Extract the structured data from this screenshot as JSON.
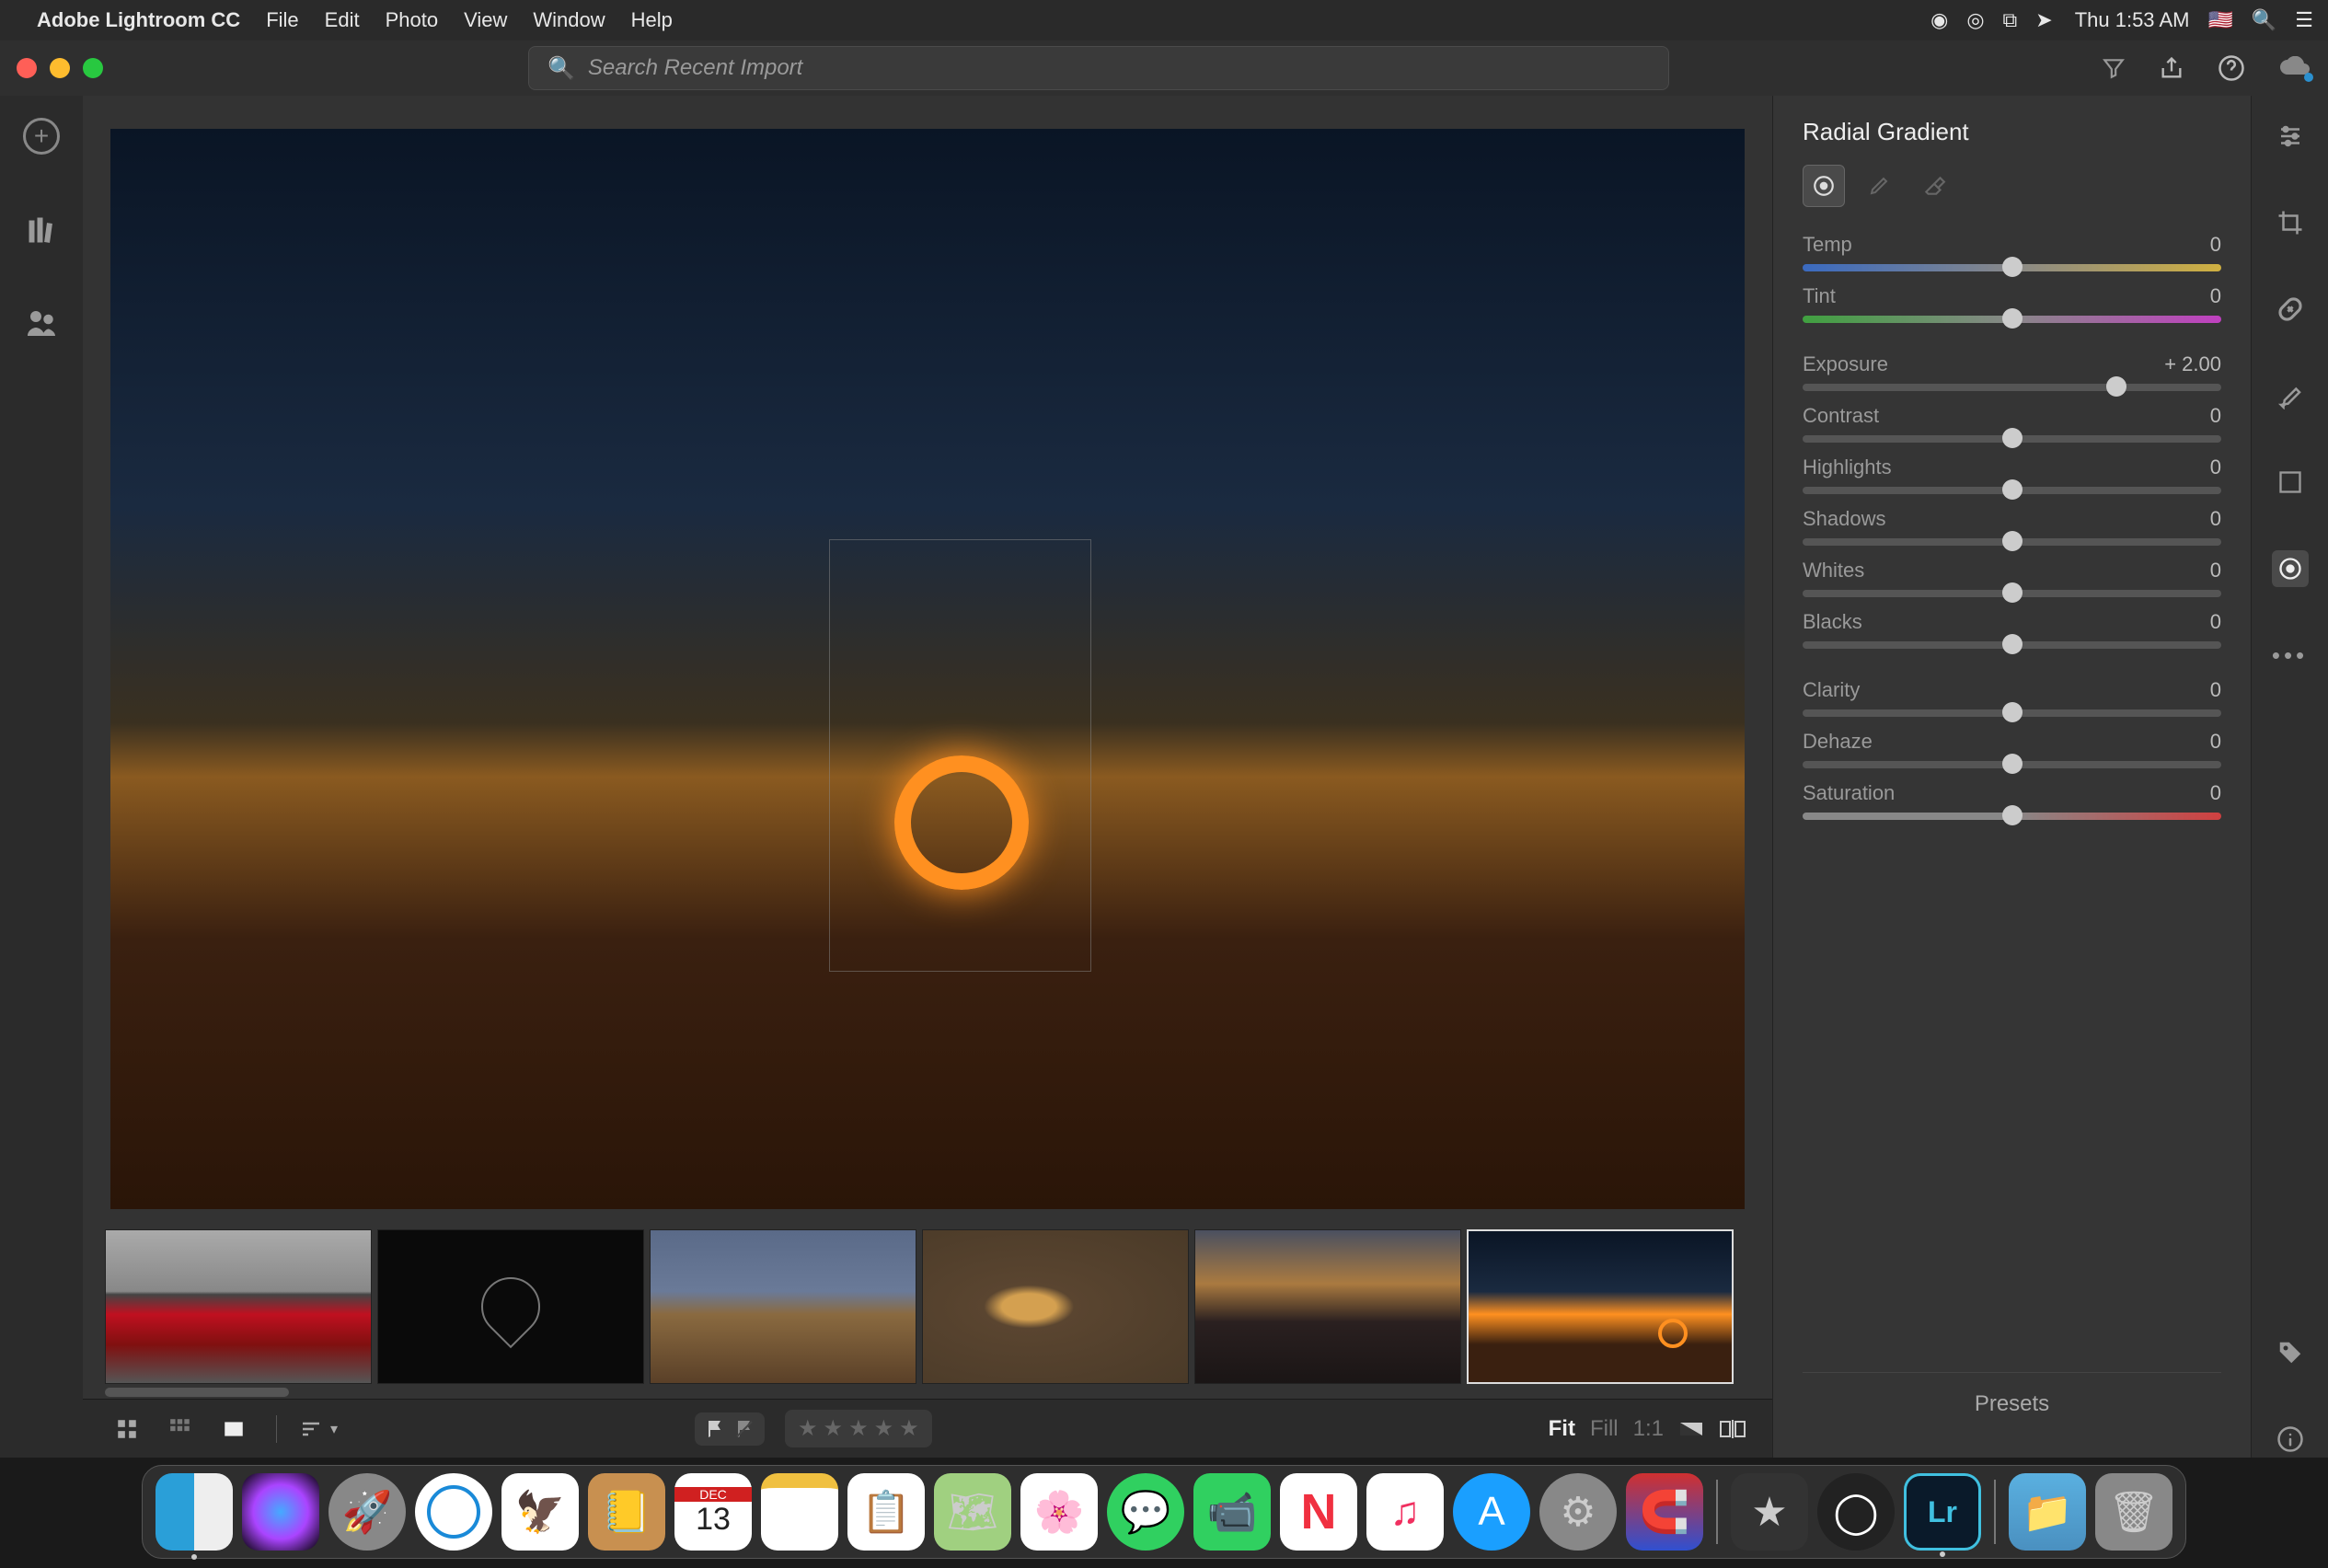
{
  "menubar": {
    "app_name": "Adobe Lightroom CC",
    "items": [
      "File",
      "Edit",
      "Photo",
      "View",
      "Window",
      "Help"
    ],
    "clock": "Thu 1:53 AM"
  },
  "toolbar": {
    "search_placeholder": "Search Recent Import"
  },
  "rightpanel": {
    "title": "Radial Gradient",
    "sliders": [
      {
        "label": "Temp",
        "value": "0",
        "pos": 50,
        "class": "temp"
      },
      {
        "label": "Tint",
        "value": "0",
        "pos": 50,
        "class": "tint"
      },
      {
        "label": "Exposure",
        "value": "+ 2.00",
        "pos": 75,
        "class": ""
      },
      {
        "label": "Contrast",
        "value": "0",
        "pos": 50,
        "class": ""
      },
      {
        "label": "Highlights",
        "value": "0",
        "pos": 50,
        "class": ""
      },
      {
        "label": "Shadows",
        "value": "0",
        "pos": 50,
        "class": ""
      },
      {
        "label": "Whites",
        "value": "0",
        "pos": 50,
        "class": ""
      },
      {
        "label": "Blacks",
        "value": "0",
        "pos": 50,
        "class": ""
      },
      {
        "label": "Clarity",
        "value": "0",
        "pos": 50,
        "class": ""
      },
      {
        "label": "Dehaze",
        "value": "0",
        "pos": 50,
        "class": ""
      },
      {
        "label": "Saturation",
        "value": "0",
        "pos": 50,
        "class": "sat"
      }
    ],
    "presets_label": "Presets"
  },
  "bottombar": {
    "fit": "Fit",
    "fill": "Fill",
    "one": "1:1"
  },
  "calendar": {
    "month": "DEC",
    "day": "13"
  },
  "lr_label": "Lr"
}
